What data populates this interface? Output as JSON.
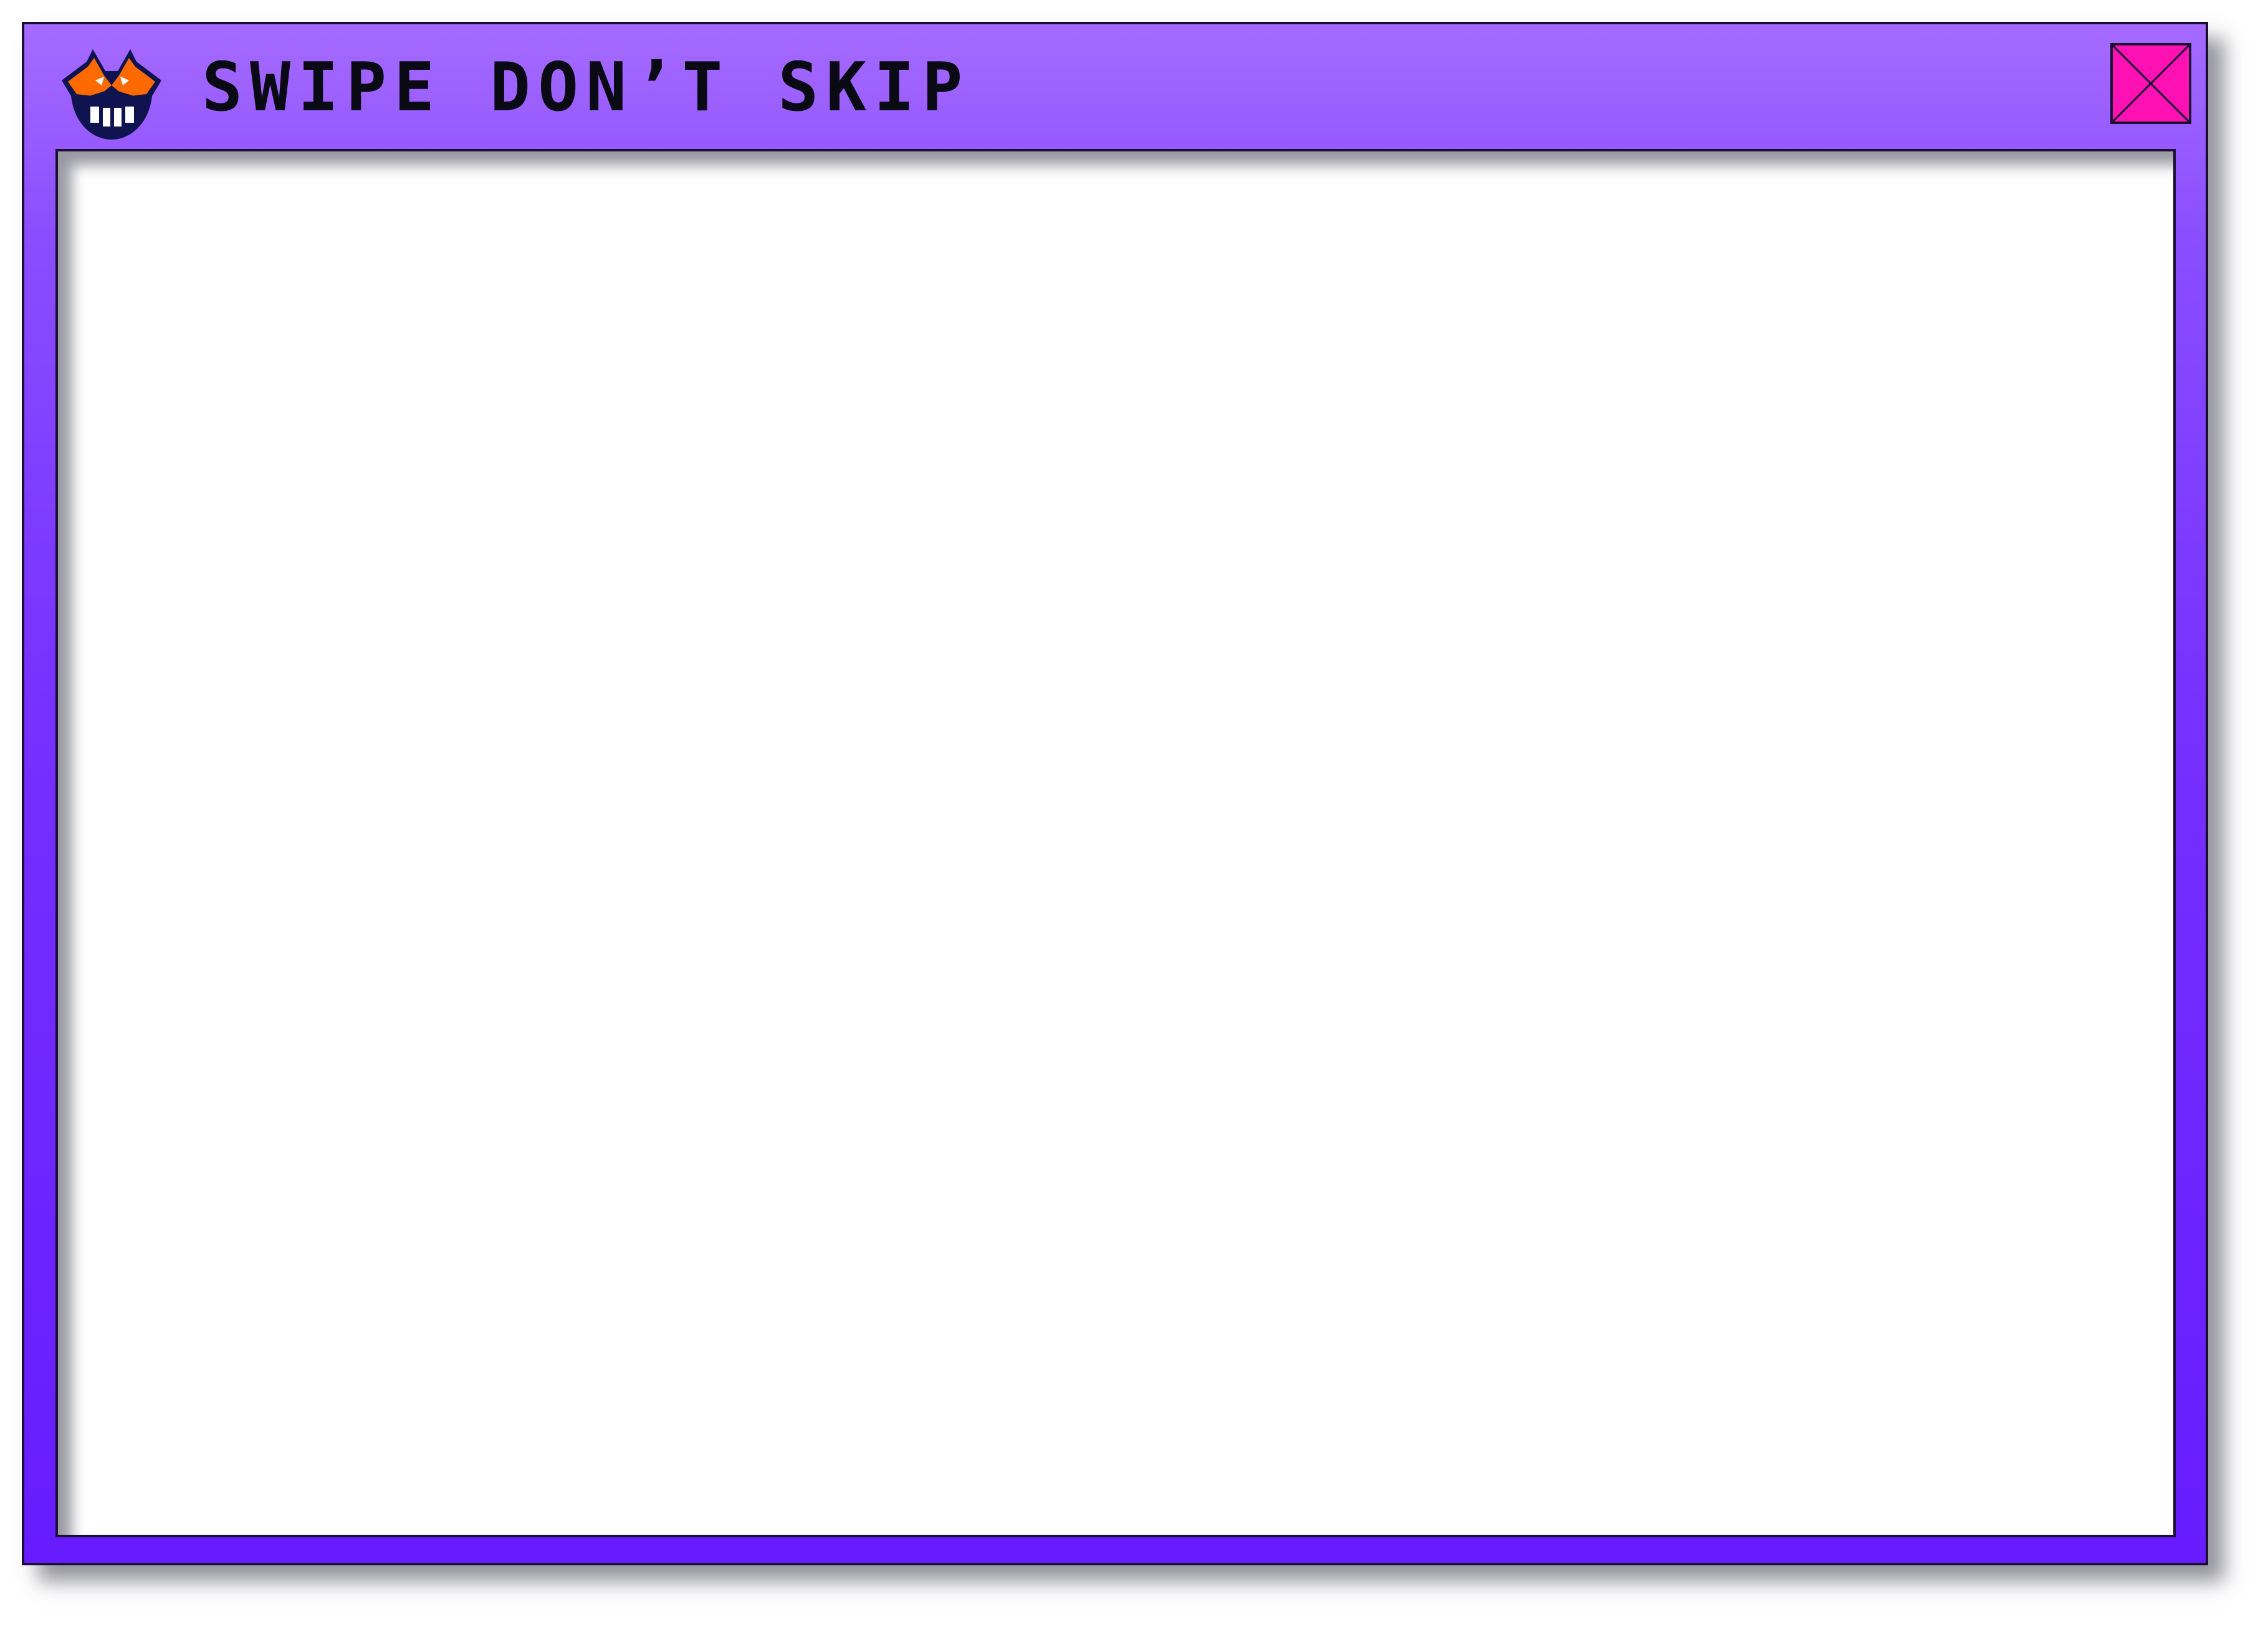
{
  "window": {
    "title": "SWIPE DON’T SKIP",
    "logo_icon": "grinning-devil-face-icon",
    "close_icon": "close-x-icon",
    "colors": {
      "titlebar_top": "#a56bff",
      "titlebar_bottom": "#661cff",
      "close_button": "#ff11b4",
      "logo_orange": "#ff6a00",
      "logo_outline": "#0f1450",
      "content_background": "#ffffff"
    }
  },
  "content": {
    "empty": true
  }
}
